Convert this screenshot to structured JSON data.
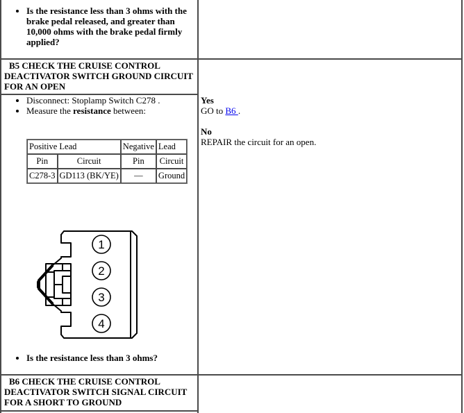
{
  "prev_step": {
    "question": "Is the resistance less than 3 ohms with the brake pedal released, and greater than 10,000 ohms with the brake pedal firmly applied?"
  },
  "b5": {
    "title_line1": "B5 CHECK THE CRUISE CONTROL",
    "title_line2": "DEACTIVATOR SWITCH GROUND CIRCUIT",
    "title_line3": "FOR AN OPEN",
    "steps": [
      {
        "prefix": "Disconnect: Stoplamp Switch C278 .",
        "bold": "",
        "suffix": ""
      },
      {
        "prefix": "Measure the ",
        "bold": "resistance",
        "suffix": " between:"
      }
    ],
    "table": {
      "header1": {
        "positive": "Positive Lead",
        "negative_a": "Negative",
        "negative_b": "Lead"
      },
      "header2": [
        "Pin",
        "Circuit",
        "Pin",
        "Circuit"
      ],
      "rows": [
        [
          "C278-3",
          "GD113 (BK/YE)",
          "—",
          "Ground"
        ]
      ]
    },
    "connector": {
      "name": "Stoplamp Switch C278",
      "pins": [
        "1",
        "2",
        "3",
        "4"
      ]
    },
    "question": "Is the resistance less than 3 ohms?",
    "answers": {
      "yes_label": "Yes",
      "yes_text_prefix": "GO to ",
      "yes_link": "B6 ",
      "yes_text_suffix": ".",
      "no_label": "No",
      "no_text": "REPAIR the circuit for an open."
    }
  },
  "b6": {
    "title_line1": "B6 CHECK THE CRUISE CONTROL",
    "title_line2": "DEACTIVATOR SWITCH SIGNAL CIRCUIT",
    "title_line3": "FOR A SHORT TO GROUND"
  }
}
